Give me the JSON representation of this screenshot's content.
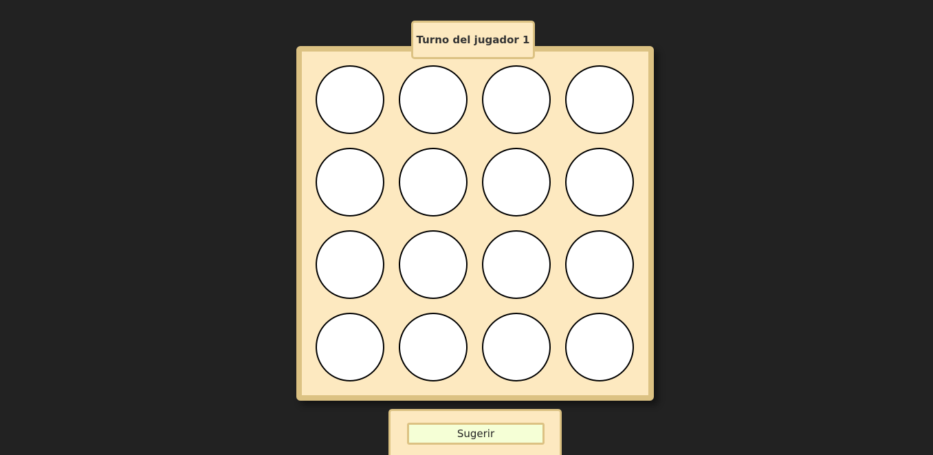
{
  "turn": {
    "label": "Turno del jugador 1",
    "player": 1
  },
  "board": {
    "rows": 4,
    "columns": 4,
    "cells": [
      [
        "empty",
        "empty",
        "empty",
        "empty"
      ],
      [
        "empty",
        "empty",
        "empty",
        "empty"
      ],
      [
        "empty",
        "empty",
        "empty",
        "empty"
      ],
      [
        "empty",
        "empty",
        "empty",
        "empty"
      ]
    ]
  },
  "controls": {
    "suggest_label": "Sugerir"
  },
  "colors": {
    "background": "#222222",
    "board_fill": "#fde9c0",
    "board_border": "#dcc283",
    "cell_fill": "#ffffff",
    "button_fill": "#f5ffd6"
  }
}
